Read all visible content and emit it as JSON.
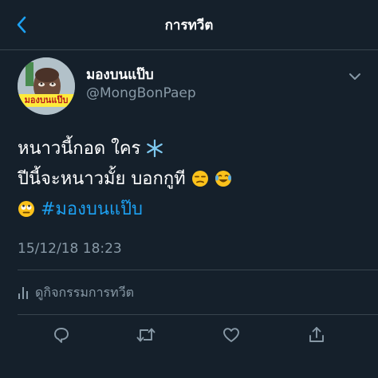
{
  "header": {
    "title": "การทวีต"
  },
  "tweet": {
    "display_name": "มองบนแป๊บ",
    "username": "@MongBonPaep",
    "avatar_caption": "มองบนแป๊บ",
    "lines": {
      "line1": "หนาวนี้กอด ใคร",
      "line2": "ปีนี้จะหนาวมั้ย บอกกูที",
      "hashtag": "#มองบนแป๊บ"
    },
    "timestamp": "15/12/18 18:23",
    "activity_label": "ดูกิจกรรมการทวีต"
  },
  "colors": {
    "background": "#15202b",
    "accent": "#1da1f2",
    "secondary_text": "#8899a6",
    "divider": "#38444d"
  },
  "icons": {
    "back": "chevron-left-icon",
    "more": "chevron-down-icon",
    "activity": "bar-chart-icon",
    "reply": "reply-icon",
    "retweet": "retweet-icon",
    "like": "heart-icon",
    "share": "share-icon"
  }
}
